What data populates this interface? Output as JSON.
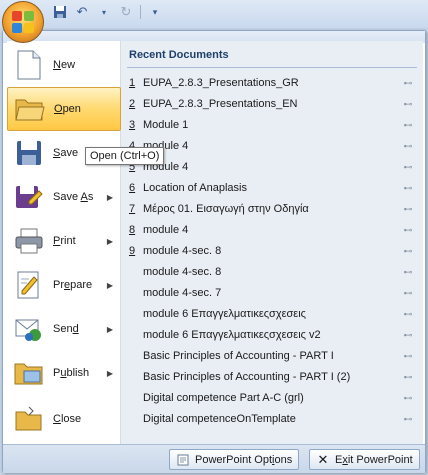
{
  "quick_access": {
    "icons": [
      "office-button",
      "save-icon",
      "undo-icon",
      "redo-icon",
      "customize-icon"
    ]
  },
  "commands": [
    {
      "label_pre": "",
      "label_u": "N",
      "label_post": "ew",
      "icon": "new-document-icon",
      "has_arrow": false
    },
    {
      "label_pre": "",
      "label_u": "O",
      "label_post": "pen",
      "icon": "open-folder-icon",
      "has_arrow": false
    },
    {
      "label_pre": "",
      "label_u": "S",
      "label_post": "ave",
      "icon": "save-disk-icon",
      "has_arrow": false
    },
    {
      "label_pre": "Save ",
      "label_u": "A",
      "label_post": "s",
      "icon": "save-as-icon",
      "has_arrow": true
    },
    {
      "label_pre": "",
      "label_u": "P",
      "label_post": "rint",
      "icon": "printer-icon",
      "has_arrow": true
    },
    {
      "label_pre": "Pr",
      "label_u": "e",
      "label_post": "pare",
      "icon": "prepare-icon",
      "has_arrow": true
    },
    {
      "label_pre": "Sen",
      "label_u": "d",
      "label_post": "",
      "icon": "send-icon",
      "has_arrow": true
    },
    {
      "label_pre": "P",
      "label_u": "u",
      "label_post": "blish",
      "icon": "publish-icon",
      "has_arrow": true
    },
    {
      "label_pre": "",
      "label_u": "C",
      "label_post": "lose",
      "icon": "close-folder-icon",
      "has_arrow": false
    }
  ],
  "tooltip": "Open (Ctrl+O)",
  "recent": {
    "title": "Recent Documents",
    "items": [
      {
        "num": "1",
        "name": "EUPA_2.8.3_Presentations_GR"
      },
      {
        "num": "2",
        "name": "EUPA_2.8.3_Presentations_EN"
      },
      {
        "num": "3",
        "name": "Module 1"
      },
      {
        "num": "4",
        "name": "module 4"
      },
      {
        "num": "5",
        "name": "module 4"
      },
      {
        "num": "6",
        "name": "Location of Anaplasis"
      },
      {
        "num": "7",
        "name": "Μέρος 01. Εισαγωγή στην Οδηγία"
      },
      {
        "num": "8",
        "name": "module 4"
      },
      {
        "num": "9",
        "name": "module 4-sec. 8"
      },
      {
        "num": "",
        "name": "module 4-sec. 8"
      },
      {
        "num": "",
        "name": "module 4-sec. 7"
      },
      {
        "num": "",
        "name": "module 6 Επαγγελματικεςσχεσεις"
      },
      {
        "num": "",
        "name": "module 6 Επαγγελματικεςσχεσεις v2"
      },
      {
        "num": "",
        "name": "Basic Principles of Accounting - PART I"
      },
      {
        "num": "",
        "name": "Basic Principles of Accounting - PART I (2)"
      },
      {
        "num": "",
        "name": "Digital competence Part A-C (grl)"
      },
      {
        "num": "",
        "name": "Digital competenceOnTemplate"
      }
    ]
  },
  "bottom": {
    "options_pre": "PowerPoint Opt",
    "options_u": "i",
    "options_post": "ons",
    "exit_pre": "E",
    "exit_u": "x",
    "exit_post": "it PowerPoint"
  }
}
